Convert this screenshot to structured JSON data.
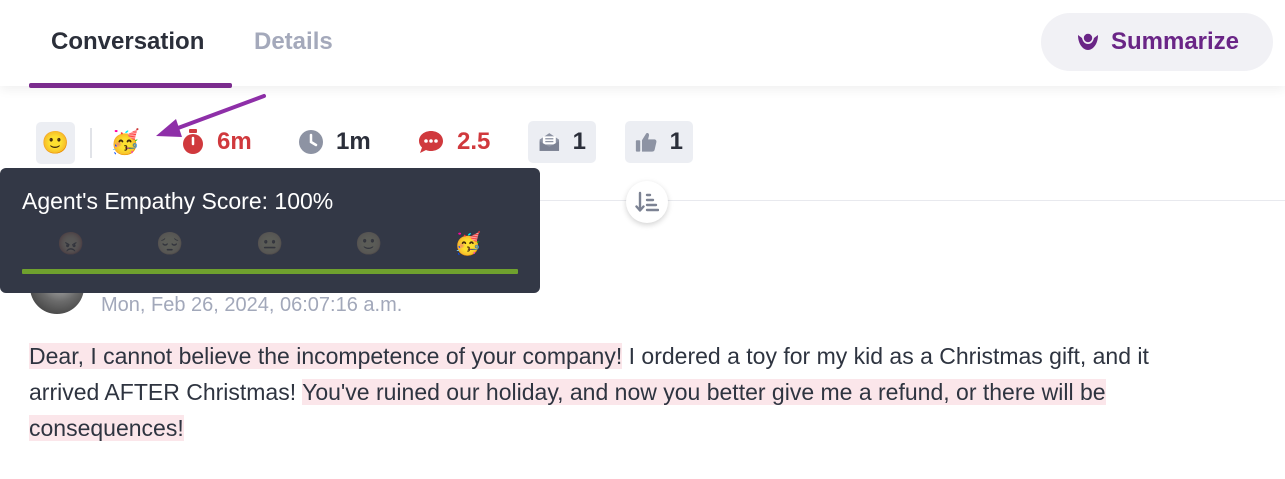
{
  "tabs": {
    "conversation": "Conversation",
    "details": "Details"
  },
  "summarize": {
    "label": "Summarize",
    "icon": "summarize-brain-icon",
    "color": "#6a2586"
  },
  "metrics": {
    "customer_sentiment_emoji": "🙂",
    "agent_empathy_emoji": "🥳",
    "first_response_time": "6m",
    "handle_time": "1m",
    "message_ratio": "2.5",
    "inbox_count": "1",
    "thumbs_up_count": "1"
  },
  "tooltip": {
    "title": "Agent's Empathy Score: 100%",
    "score_percent": 100,
    "scale": [
      "😡",
      "😔",
      "😐",
      "🙂",
      "🥳"
    ],
    "active_index": 4,
    "bar_color": "#6fa12e"
  },
  "message": {
    "timestamp": "Mon, Feb 26, 2024, 06:07:16 a.m.",
    "segment_1": "Dear, I cannot believe the incompetence of your company!",
    "segment_2": " I ordered a toy for my kid as a Christmas gift, and it arrived AFTER Christmas! ",
    "segment_3": "You've ruined our holiday, and now you better give me a refund, or there will be consequences!"
  },
  "colors": {
    "accent": "#7b2c8e",
    "red_metric": "#d0393d",
    "highlight": "#fbe6ea"
  }
}
